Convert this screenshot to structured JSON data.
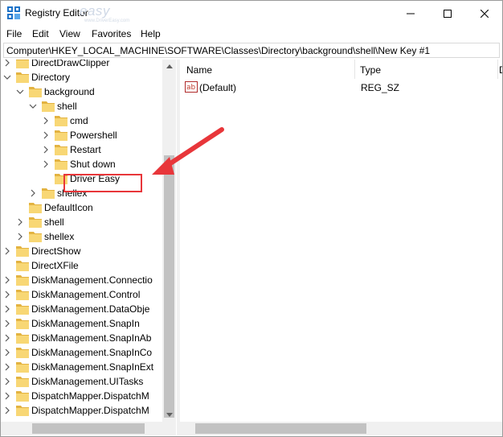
{
  "window": {
    "title": "Registry Editor",
    "watermark": "easy",
    "watermark_sub": "www.DriverEasy.com"
  },
  "menu": [
    "File",
    "Edit",
    "View",
    "Favorites",
    "Help"
  ],
  "address": "Computer\\HKEY_LOCAL_MACHINE\\SOFTWARE\\Classes\\Directory\\background\\shell\\New Key #1",
  "tree": [
    {
      "label": "DirectDrawClipper",
      "chev": "right"
    },
    {
      "label": "Directory",
      "chev": "down"
    },
    {
      "label": "background",
      "chev": "down"
    },
    {
      "label": "shell",
      "chev": "down"
    },
    {
      "label": "cmd",
      "chev": "right"
    },
    {
      "label": "Powershell",
      "chev": "right"
    },
    {
      "label": "Restart",
      "chev": "right"
    },
    {
      "label": "Shut down",
      "chev": "right"
    },
    {
      "label": "Driver Easy",
      "chev": "none"
    },
    {
      "label": "shellex",
      "chev": "right"
    },
    {
      "label": "DefaultIcon",
      "chev": "none"
    },
    {
      "label": "shell",
      "chev": "right"
    },
    {
      "label": "shellex",
      "chev": "right"
    },
    {
      "label": "DirectShow",
      "chev": "right"
    },
    {
      "label": "DirectXFile",
      "chev": "none"
    },
    {
      "label": "DiskManagement.Connectio",
      "chev": "right"
    },
    {
      "label": "DiskManagement.Control",
      "chev": "right"
    },
    {
      "label": "DiskManagement.DataObje",
      "chev": "right"
    },
    {
      "label": "DiskManagement.SnapIn",
      "chev": "right"
    },
    {
      "label": "DiskManagement.SnapInAb",
      "chev": "right"
    },
    {
      "label": "DiskManagement.SnapInCo",
      "chev": "right"
    },
    {
      "label": "DiskManagement.SnapInExt",
      "chev": "right"
    },
    {
      "label": "DiskManagement.UITasks",
      "chev": "right"
    },
    {
      "label": "DispatchMapper.DispatchM",
      "chev": "right"
    },
    {
      "label": "DispatchMapper.DispatchM",
      "chev": "right"
    }
  ],
  "columns": {
    "name": "Name",
    "type": "Type",
    "data": "D"
  },
  "values": [
    {
      "name": "(Default)",
      "type": "REG_SZ",
      "icon": "ab"
    }
  ],
  "colors": {
    "folder": "#f8d775",
    "folder_dark": "#e3b341",
    "annotation": "#e8363a",
    "icon_blue": "#1e73c8"
  }
}
